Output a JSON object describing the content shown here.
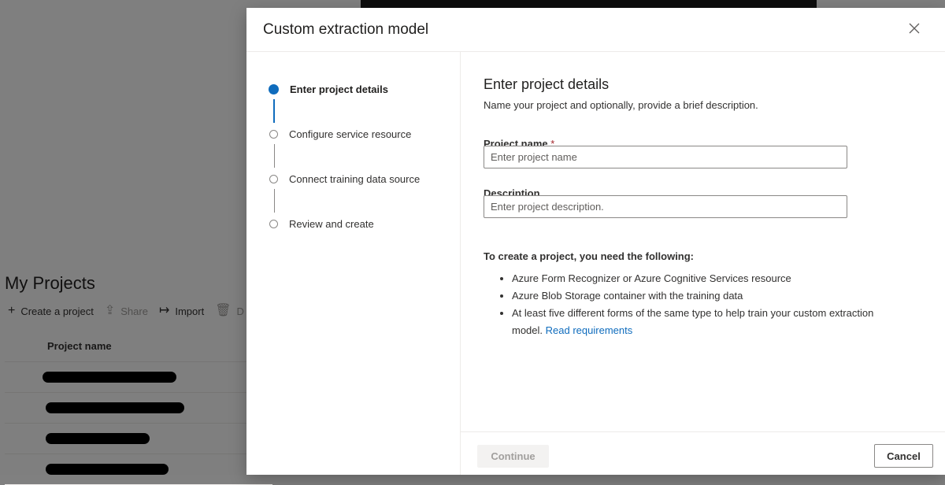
{
  "background": {
    "page_title": "My Projects",
    "toolbar": [
      {
        "icon": "plus-icon",
        "glyph": "+",
        "label": "Create a project",
        "disabled": false
      },
      {
        "icon": "share-icon",
        "glyph": "⇪",
        "label": "Share",
        "disabled": true
      },
      {
        "icon": "import-icon",
        "glyph": "↦",
        "label": "Import",
        "disabled": false
      },
      {
        "icon": "delete-icon",
        "glyph": "🗑",
        "label": "D",
        "disabled": true
      }
    ],
    "table": {
      "column_header": "Project name"
    }
  },
  "dialog": {
    "title": "Custom extraction model",
    "close_icon": "close-icon",
    "steps": [
      {
        "label": "Enter project details",
        "active": true
      },
      {
        "label": "Configure service resource",
        "active": false
      },
      {
        "label": "Connect training data source",
        "active": false
      },
      {
        "label": "Review and create",
        "active": false
      }
    ],
    "content": {
      "title": "Enter project details",
      "subtitle": "Name your project and optionally, provide a brief description.",
      "project_name_label": "Project name",
      "required_marker": "*",
      "project_name_placeholder": "Enter project name",
      "project_name_value": "",
      "description_label": "Description",
      "description_placeholder": "Enter project description.",
      "description_value": "",
      "requirements_heading": "To create a project, you need the following:",
      "requirements": [
        "Azure Form Recognizer or Azure Cognitive Services resource",
        "Azure Blob Storage container with the training data",
        "At least five different forms of the same type to help train your custom extraction model."
      ],
      "requirements_link": "Read requirements"
    },
    "footer": {
      "continue_label": "Continue",
      "cancel_label": "Cancel"
    }
  },
  "colors": {
    "accent": "#0f6cbd",
    "required": "#a4262c",
    "overlay": "rgba(0,0,0,0.5)"
  }
}
